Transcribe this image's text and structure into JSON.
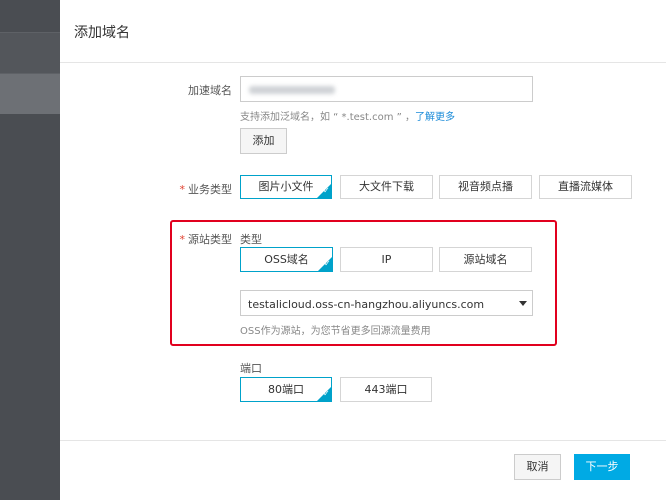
{
  "dialog": {
    "title": "添加域名",
    "domain_label": "加速域名",
    "domain_hint_prefix": "支持添加泛域名，如 “ *.test.com ” ，",
    "domain_hint_link": "了解更多",
    "add_button": "添加",
    "biz_label": "业务类型",
    "biz_options": [
      "图片小文件",
      "大文件下载",
      "视音频点播",
      "直播流媒体"
    ],
    "biz_selected": "图片小文件",
    "origin_label": "源站类型",
    "origin_type_label": "类型",
    "origin_options": [
      "OSS域名",
      "IP",
      "源站域名"
    ],
    "origin_selected": "OSS域名",
    "origin_select_value": "testalicloud.oss-cn-hangzhou.aliyuncs.com",
    "origin_hint": "OSS作为源站，为您节省更多回源流量费用",
    "port_label": "端口",
    "port_options": [
      "80端口",
      "443端口"
    ],
    "port_selected": "80端口",
    "cancel_button": "取消",
    "next_button": "下一步"
  },
  "colors": {
    "accent": "#00a2ca",
    "primary_button": "#00aae4",
    "required": "#e0412f",
    "highlight_box": "#e1001e",
    "link": "#1a8bd8",
    "sidebar": "#4a4d52"
  }
}
